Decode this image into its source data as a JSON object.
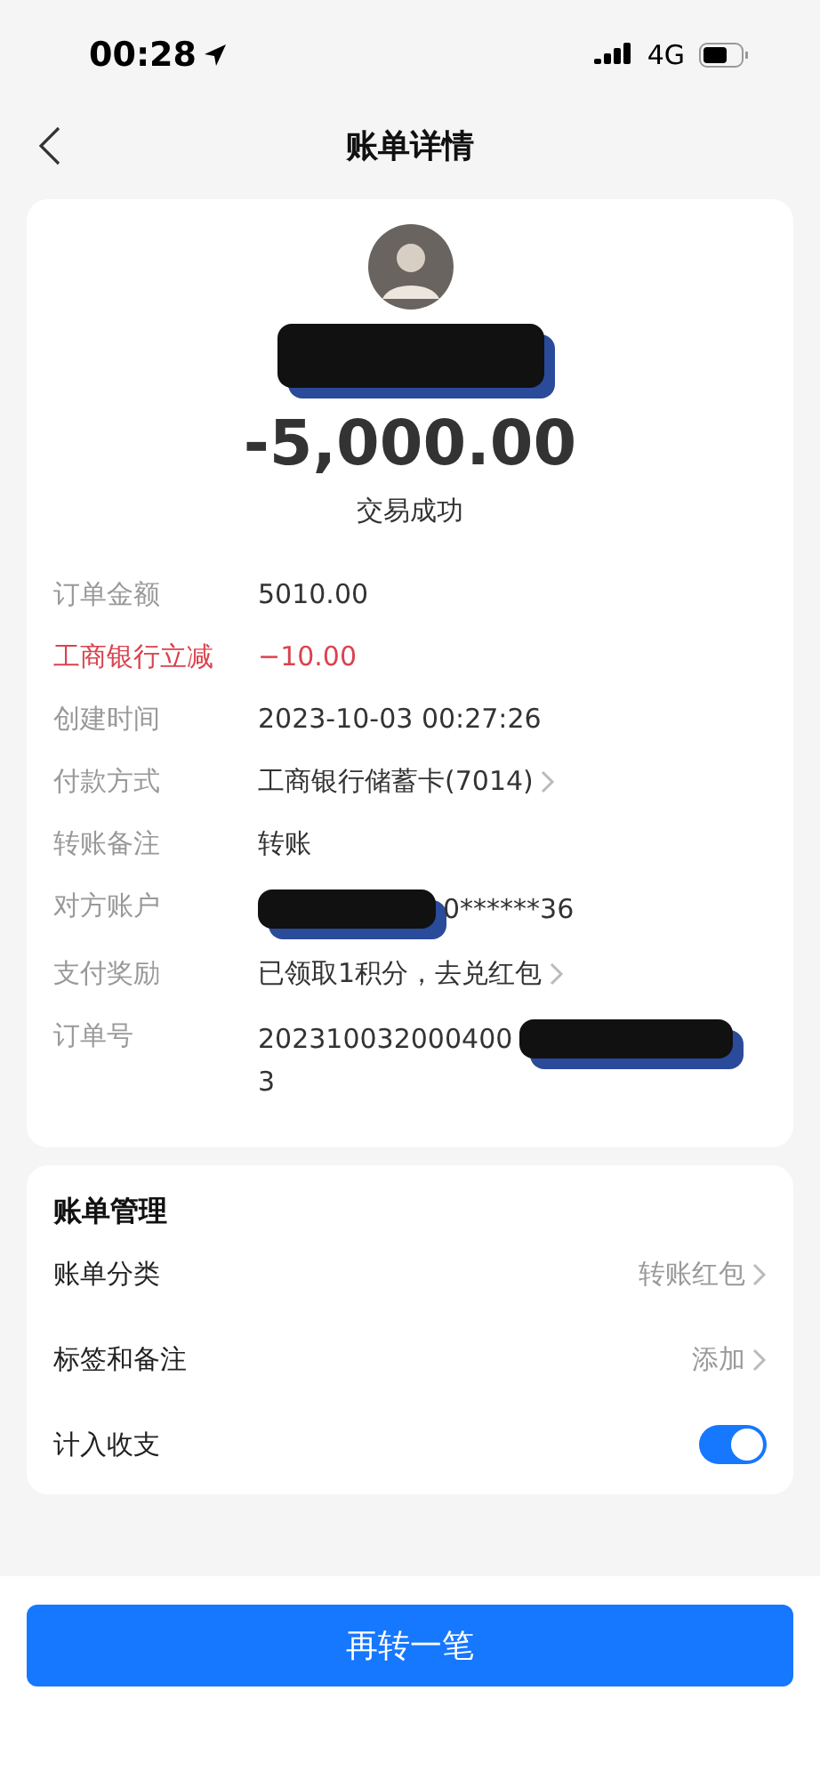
{
  "status_bar": {
    "time": "00:28",
    "network": "4G"
  },
  "nav": {
    "title": "账单详情"
  },
  "summary": {
    "amount": "-5,000.00",
    "status": "交易成功",
    "name_redacted": true
  },
  "details": [
    {
      "label": "订单金额",
      "value": "5010.00",
      "kind": "plain",
      "chevron": false
    },
    {
      "label": "工商银行立减",
      "value": "−10.00",
      "kind": "discount",
      "chevron": false
    },
    {
      "label": "创建时间",
      "value": "2023-10-03 00:27:26",
      "kind": "plain",
      "chevron": false
    },
    {
      "label": "付款方式",
      "value": "工商银行储蓄卡(7014)",
      "kind": "plain",
      "chevron": true
    },
    {
      "label": "转账备注",
      "value": "转账",
      "kind": "plain",
      "chevron": false
    },
    {
      "label": "对方账户",
      "value": "0******36",
      "kind": "plain",
      "chevron": false,
      "redacted_before": true
    },
    {
      "label": "支付奖励",
      "value": "已领取1积分，去兑红包",
      "kind": "plain",
      "chevron": true
    },
    {
      "label": "订单号",
      "value": "202310032000400",
      "continuation": "3",
      "kind": "plain",
      "chevron": false,
      "redacted_after": true
    }
  ],
  "management": {
    "title": "账单管理",
    "items": [
      {
        "label": "账单分类",
        "value": "转账红包",
        "kind": "link"
      },
      {
        "label": "标签和备注",
        "value": "添加",
        "kind": "link"
      },
      {
        "label": "计入收支",
        "kind": "switch",
        "on": true
      }
    ]
  },
  "action_button": "再转一笔"
}
